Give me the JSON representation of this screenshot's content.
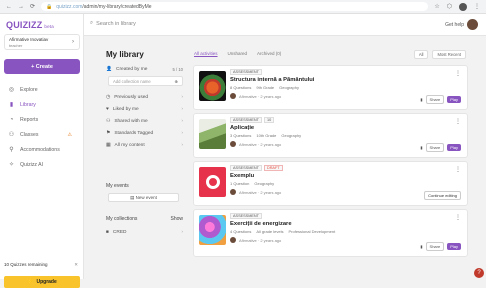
{
  "browser": {
    "url_host": "quizizz.com",
    "url_path": "/admin/my-library/createdByMe"
  },
  "sidebar": {
    "logo": "QUIZIZZ",
    "logo_sub": "beta",
    "account": {
      "name": "Afirmative Inovatiav",
      "sub": "teacher"
    },
    "create_label": "+ Create",
    "nav": [
      {
        "label": "Explore",
        "icon": "compass-icon",
        "active": false
      },
      {
        "label": "Library",
        "icon": "library-icon",
        "active": true
      },
      {
        "label": "Reports",
        "icon": "reports-icon",
        "active": false
      },
      {
        "label": "Classes",
        "icon": "classes-icon",
        "active": false
      },
      {
        "label": "Accommodations",
        "icon": "accommodations-icon",
        "active": false
      },
      {
        "label": "Quizizz AI",
        "icon": "ai-icon",
        "active": false
      }
    ],
    "promo_text": "10 Quizzes remaining",
    "upgrade_label": "Upgrade"
  },
  "topbar": {
    "search_placeholder": "Search in library",
    "account_label": "Get help"
  },
  "library": {
    "title": "My library",
    "tabs": [
      "All activities",
      "Unshared",
      "Archived (0)"
    ],
    "filters": [
      "All",
      "Most Recent"
    ],
    "left_items": [
      {
        "label": "Created by me",
        "count": "5 / 10"
      },
      {
        "label": "Previously used"
      },
      {
        "label": "Liked by me"
      },
      {
        "label": "Shared with me"
      },
      {
        "label": "Standards Tagged"
      },
      {
        "label": "All my content"
      }
    ],
    "new_folder_placeholder": "Add collection name",
    "my_events": "My events",
    "new_event": "New event",
    "collections_label": "My collections",
    "collections_action": "Show",
    "collection_item": "CRED"
  },
  "cards": [
    {
      "tags": [
        "ASSESSMENT"
      ],
      "title": "Structura internă a Pământului",
      "meta": [
        "8 Questions",
        "9th Grade",
        "Geography"
      ],
      "owner": "Afirmative · 2 years ago",
      "actions": [
        "Share",
        "Play"
      ],
      "thumb_color": "#1a1a1a"
    },
    {
      "tags": [
        "ASSESSMENT",
        "10"
      ],
      "title": "Aplicație",
      "meta": [
        "3 Questions",
        "10th Grade",
        "Geography"
      ],
      "owner": "Afirmative · 2 years ago",
      "actions": [
        "Share",
        "Play"
      ],
      "thumb_color": "#7aa05a"
    },
    {
      "tags": [
        "ASSESSMENT",
        "DRAFT"
      ],
      "title": "Exemplu",
      "meta": [
        "1 Question",
        "Geography"
      ],
      "owner": "Afirmative · 2 years ago",
      "actions": [
        "Continue editing"
      ],
      "thumb_color": "#e6334b"
    },
    {
      "tags": [
        "ASSESSMENT"
      ],
      "title": "Exerciții de energizare",
      "meta": [
        "4 Questions",
        "All grade levels",
        "Professional Development"
      ],
      "owner": "Afirmative · 2 years ago",
      "actions": [
        "Share",
        "Play"
      ],
      "thumb_color": "#b05ad0"
    }
  ]
}
